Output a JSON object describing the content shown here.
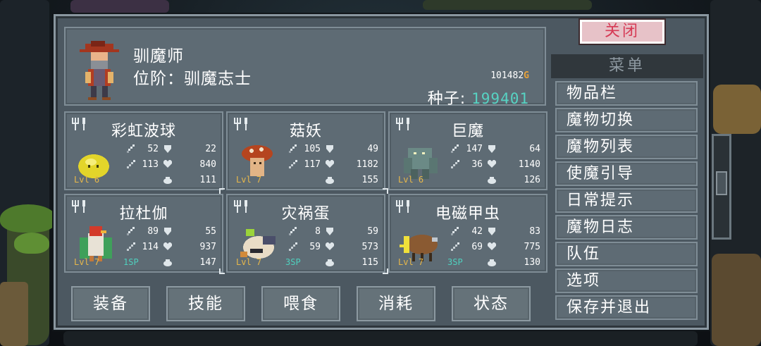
{
  "header": {
    "name": "驯魔师",
    "rank": "位阶：驯魔志士",
    "gold_amount": "101482",
    "gold_unit": "G",
    "seed_label": "种子:",
    "seed_value": "199401"
  },
  "monsters": [
    {
      "name": "彩虹波球",
      "level": "Lvl 6",
      "sp": "",
      "atk": "52",
      "def": "22",
      "magic": "113",
      "hp": "840",
      "mana": "111",
      "sprite": "yellow-blob"
    },
    {
      "name": "菇妖",
      "level": "Lvl 7",
      "sp": "",
      "atk": "105",
      "def": "49",
      "magic": "117",
      "hp": "1182",
      "mana": "155",
      "sprite": "mushroom"
    },
    {
      "name": "巨魔",
      "level": "Lvl 6",
      "sp": "",
      "atk": "147",
      "def": "64",
      "magic": "36",
      "hp": "1140",
      "mana": "126",
      "sprite": "troll"
    },
    {
      "name": "拉杜伽",
      "level": "Lvl 7",
      "sp": "1SP",
      "atk": "89",
      "def": "55",
      "magic": "114",
      "hp": "937",
      "mana": "147",
      "sprite": "bird-warrior"
    },
    {
      "name": "灾祸蛋",
      "level": "Lvl 7",
      "sp": "3SP",
      "atk": "8",
      "def": "59",
      "magic": "59",
      "hp": "573",
      "mana": "115",
      "sprite": "egg-creature"
    },
    {
      "name": "电磁甲虫",
      "level": "Lvl 7",
      "sp": "3SP",
      "atk": "42",
      "def": "83",
      "magic": "69",
      "hp": "775",
      "mana": "130",
      "sprite": "beetle"
    }
  ],
  "bottom_buttons": [
    "装备",
    "技能",
    "喂食",
    "消耗",
    "状态"
  ],
  "menu": {
    "close_label": "关闭",
    "title": "菜单",
    "items": [
      "物品栏",
      "魔物切换",
      "魔物列表",
      "使魔引导",
      "日常提示",
      "魔物日志",
      "队伍",
      "选项",
      "保存并退出"
    ]
  },
  "colors": {
    "panel": "#5e6b74",
    "window": "#4c5861",
    "gold": "#e8a23a",
    "seed_value": "#57d3c3",
    "level": "#e8b84a",
    "close_text": "#d63a55",
    "close_bg": "#e7c2c8"
  },
  "icons": {
    "atk": "sword-icon",
    "def": "shield-icon",
    "magic": "wand-icon",
    "hp": "heart-icon",
    "mana": "mana-icon",
    "shift": "fork-icon"
  }
}
